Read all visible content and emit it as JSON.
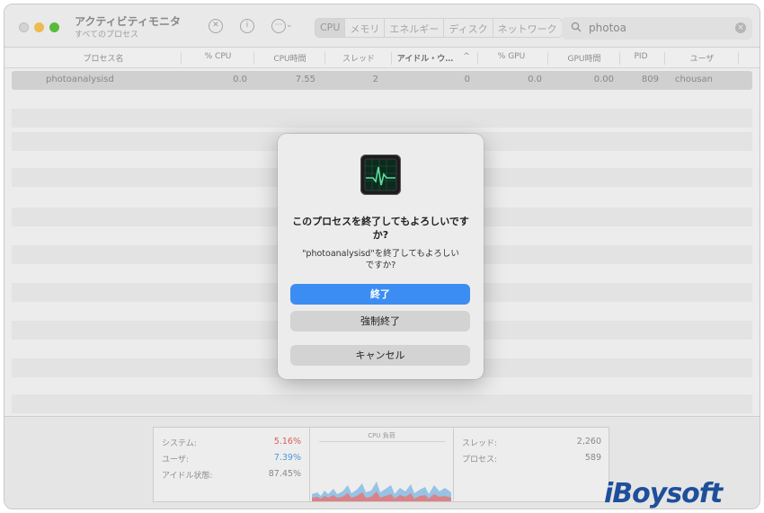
{
  "window": {
    "title": "アクティビティモニタ",
    "subtitle": "すべてのプロセス"
  },
  "toolbar": {
    "stop_icon": "stop-x-icon",
    "info_icon": "info-icon",
    "more_icon": "ellipsis-icon",
    "tabs": [
      "CPU",
      "メモリ",
      "エネルギー",
      "ディスク",
      "ネットワーク"
    ],
    "active_tab": "CPU",
    "search_value": "photoa"
  },
  "table": {
    "columns": [
      "プロセス名",
      "% CPU",
      "CPU時間",
      "スレッド",
      "アイドル・ウ…",
      "% GPU",
      "GPU時間",
      "PID",
      "ユーザ"
    ],
    "sort_indicator": "^",
    "rows": [
      {
        "name": "photoanalysisd",
        "cpu": "0.0",
        "cpu_time": "7.55",
        "threads": "2",
        "idle_wake": "0",
        "gpu": "0.0",
        "gpu_time": "0.00",
        "pid": "809",
        "user": "chousan"
      }
    ]
  },
  "stats": {
    "system_label": "システム:",
    "system_value": "5.16%",
    "user_label": "ユーザ:",
    "user_value": "7.39%",
    "idle_label": "アイドル状態:",
    "idle_value": "87.45%",
    "graph_title": "CPU 負荷",
    "threads_label": "スレッド:",
    "threads_value": "2,260",
    "processes_label": "プロセス:",
    "processes_value": "589",
    "colors": {
      "system": "#e05a5a",
      "user": "#4a9be0"
    }
  },
  "dialog": {
    "title": "このプロセスを終了してもよろしいですか?",
    "message": "\"photoanalysisd\"を終了してもよろしいですか?",
    "quit_label": "終了",
    "force_quit_label": "強制終了",
    "cancel_label": "キャンセル",
    "primary_color": "#3c8df3"
  },
  "watermark": "iBoysoft"
}
